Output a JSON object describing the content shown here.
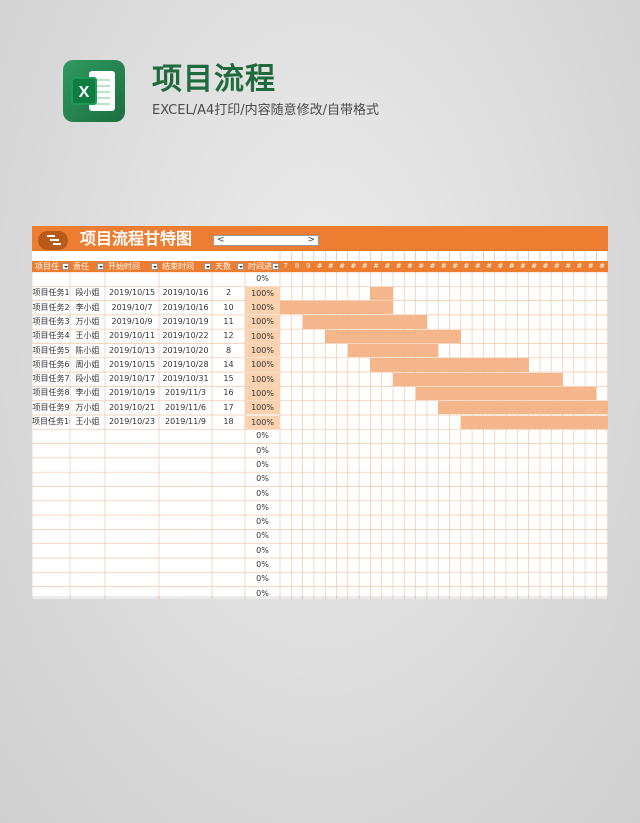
{
  "header": {
    "title": "项目流程",
    "subtitle": "EXCEL/A4打印/内容随意修改/自带格式",
    "logo_letter": "X",
    "logo_icon": "excel-icon"
  },
  "sheet": {
    "title": "项目流程甘特图",
    "scroll_left": "<",
    "scroll_right": ">",
    "columns": [
      "项目任",
      "责任",
      "开始时间",
      "结束时间",
      "天数",
      "时间进"
    ],
    "weekday_row": [
      "一",
      "二",
      "三",
      "四",
      "五",
      "六",
      "日",
      "一",
      "二",
      "三",
      "四",
      "五",
      "六",
      "日",
      "一",
      "二",
      "三",
      "四",
      "五",
      "六",
      "日",
      "一",
      "二",
      "三",
      "四",
      "五",
      "六",
      "日",
      "一",
      "二",
      "三",
      "四",
      "五",
      "六",
      "日",
      "一"
    ],
    "day_row": [
      "7",
      "8",
      "9",
      "#",
      "#",
      "#",
      "#",
      "#",
      "#",
      "#",
      "#",
      "#",
      "#",
      "#",
      "#",
      "#",
      "#",
      "#",
      "#",
      "#",
      "#",
      "#",
      "#",
      "#",
      "#",
      "#",
      "#",
      "#",
      "#",
      "#",
      "#",
      "1",
      "2",
      "3",
      "4"
    ],
    "first_row_progress": "0%",
    "tasks": [
      {
        "name": "项目任务1",
        "owner": "段小姐",
        "start": "2019/10/15",
        "end": "2019/10/16",
        "days": "2",
        "progress": "100%",
        "offset": 8,
        "len": 2
      },
      {
        "name": "项目任务2",
        "owner": "李小姐",
        "start": "2019/10/7",
        "end": "2019/10/16",
        "days": "10",
        "progress": "100%",
        "offset": 0,
        "len": 10
      },
      {
        "name": "项目任务3",
        "owner": "万小姐",
        "start": "2019/10/9",
        "end": "2019/10/19",
        "days": "11",
        "progress": "100%",
        "offset": 2,
        "len": 11
      },
      {
        "name": "项目任务4",
        "owner": "王小姐",
        "start": "2019/10/11",
        "end": "2019/10/22",
        "days": "12",
        "progress": "100%",
        "offset": 4,
        "len": 12
      },
      {
        "name": "项目任务5",
        "owner": "陈小姐",
        "start": "2019/10/13",
        "end": "2019/10/20",
        "days": "8",
        "progress": "100%",
        "offset": 6,
        "len": 8
      },
      {
        "name": "项目任务6",
        "owner": "周小姐",
        "start": "2019/10/15",
        "end": "2019/10/28",
        "days": "14",
        "progress": "100%",
        "offset": 8,
        "len": 14
      },
      {
        "name": "项目任务7",
        "owner": "段小姐",
        "start": "2019/10/17",
        "end": "2019/10/31",
        "days": "15",
        "progress": "100%",
        "offset": 10,
        "len": 15
      },
      {
        "name": "项目任务8",
        "owner": "李小姐",
        "start": "2019/10/19",
        "end": "2019/11/3",
        "days": "16",
        "progress": "100%",
        "offset": 12,
        "len": 16
      },
      {
        "name": "项目任务9",
        "owner": "万小姐",
        "start": "2019/10/21",
        "end": "2019/11/6",
        "days": "17",
        "progress": "100%",
        "offset": 14,
        "len": 17
      },
      {
        "name": "项目任务10",
        "owner": "王小姐",
        "start": "2019/10/23",
        "end": "2019/11/9",
        "days": "18",
        "progress": "100%",
        "offset": 16,
        "len": 18
      }
    ],
    "empty_progress": [
      "0%",
      "0%",
      "0%",
      "0%",
      "0%",
      "0%",
      "0%",
      "0%",
      "0%",
      "0%",
      "0%",
      "0%"
    ]
  },
  "colors": {
    "accent": "#ed7d31",
    "bar": "#f6b68b",
    "progress_bg": "#fbd2b0",
    "grid": "#f3c7a6",
    "title_green": "#1f6b3e"
  }
}
